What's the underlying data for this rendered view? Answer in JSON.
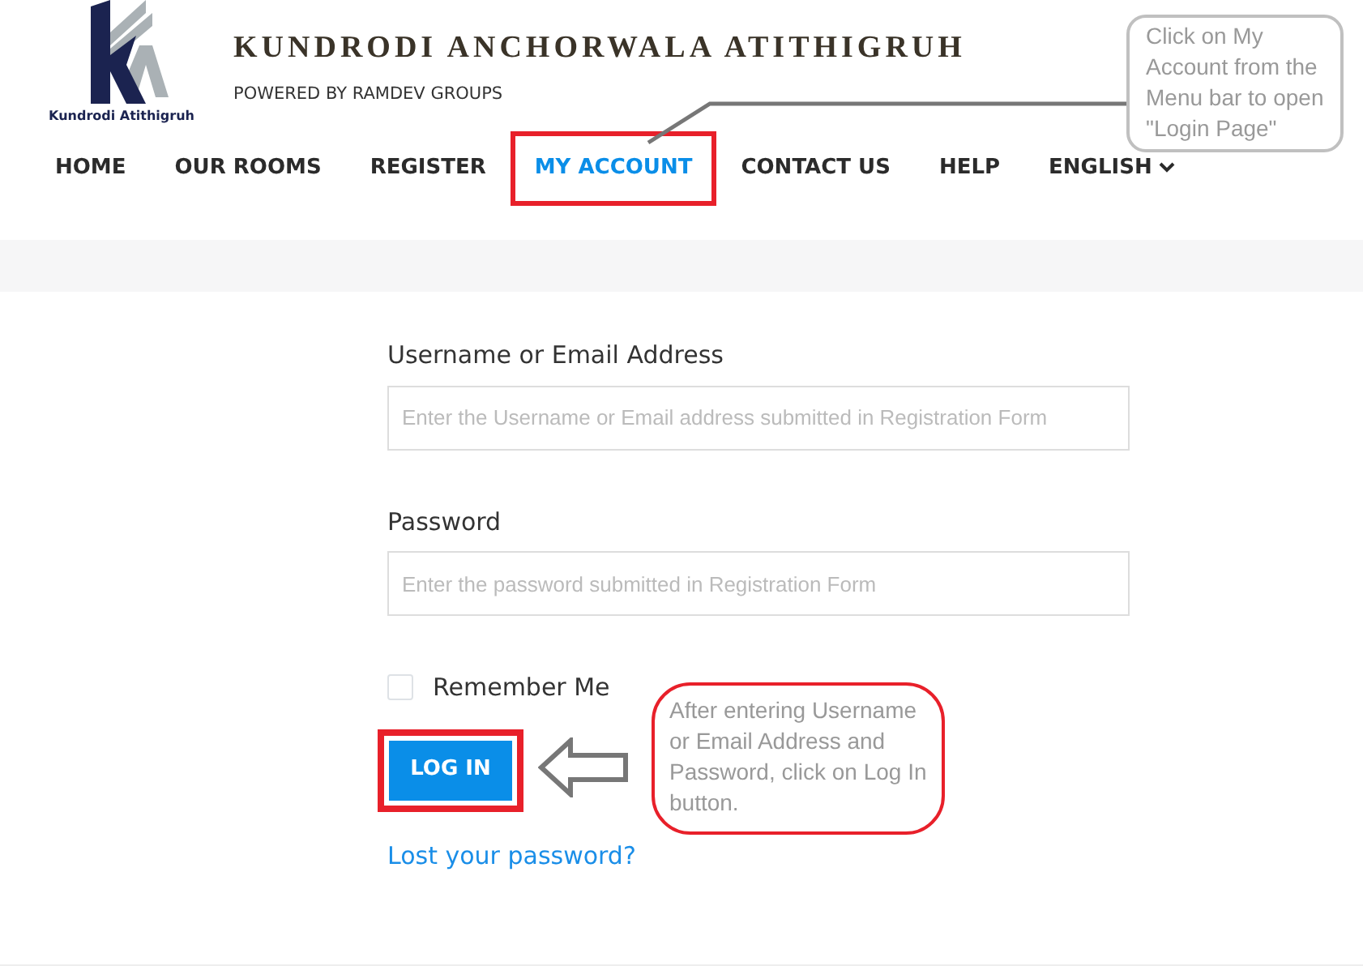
{
  "logo": {
    "caption": "Kundrodi Atithigruh"
  },
  "site": {
    "title": "KUNDRODI ANCHORWALA ATITHIGRUH",
    "tagline": "POWERED BY RAMDEV GROUPS"
  },
  "nav": [
    {
      "label": "HOME",
      "selected": false,
      "highlighted": false
    },
    {
      "label": "OUR ROOMS",
      "selected": false,
      "highlighted": false
    },
    {
      "label": "REGISTER",
      "selected": false,
      "highlighted": false
    },
    {
      "label": "MY ACCOUNT",
      "selected": true,
      "highlighted": true
    },
    {
      "label": "CONTACT US",
      "selected": false,
      "highlighted": false
    },
    {
      "label": "HELP",
      "selected": false,
      "highlighted": false
    },
    {
      "label": "ENGLISH",
      "selected": false,
      "highlighted": false,
      "dropdown": true
    }
  ],
  "form": {
    "fields": [
      {
        "label": "Username or Email Address",
        "placeholder": "Enter the Username or Email address submitted in Registration Form"
      },
      {
        "label": "Password",
        "placeholder": "Enter the password submitted in Registration Form"
      }
    ],
    "remember": {
      "label": "Remember Me",
      "checked": false
    },
    "submit": {
      "label": "LOG IN",
      "highlighted": true
    },
    "lost_link": "Lost your password?"
  },
  "callouts": [
    {
      "text": "Click on My Account from the Menu bar to open \"Login Page\"",
      "color": "#c0c0c0",
      "kind": "leader"
    },
    {
      "text": "After entering Username or Email Address and Password, click on Log In button.",
      "color": "#e8202a",
      "kind": "arrow"
    }
  ]
}
